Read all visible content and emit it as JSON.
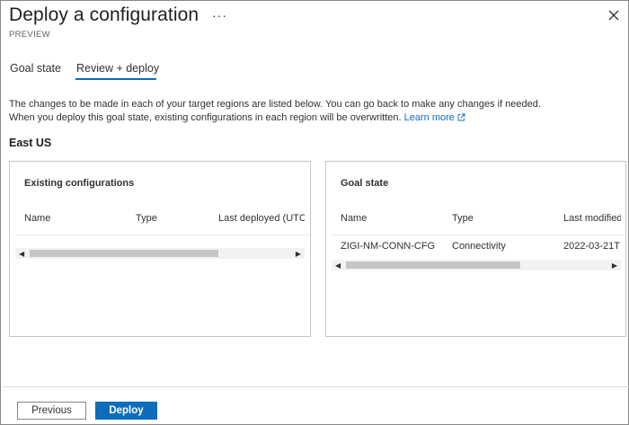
{
  "header": {
    "title": "Deploy a configuration",
    "subtitle": "PREVIEW",
    "more_label": "···"
  },
  "tabs": [
    {
      "label": "Goal state",
      "selected": false
    },
    {
      "label": "Review + deploy",
      "selected": true
    }
  ],
  "description": {
    "line1": "The changes to be made in each of your target regions are listed below. You can go back to make any changes if needed.",
    "line2": "When you deploy this goal state, existing configurations in each region will be overwritten.",
    "link": "Learn more"
  },
  "region": "East US",
  "existing": {
    "title": "Existing configurations",
    "columns": [
      "Name",
      "Type",
      "Last deployed (UTC)"
    ],
    "rows": []
  },
  "goal": {
    "title": "Goal state",
    "columns": [
      "Name",
      "Type",
      "Last modified"
    ],
    "rows": [
      {
        "name": "ZIGI-NM-CONN-CFG",
        "type": "Connectivity",
        "last": "2022-03-21T"
      }
    ]
  },
  "footer": {
    "previous": "Previous",
    "deploy": "Deploy"
  },
  "colors": {
    "accent": "#0f6cbd",
    "border": "#c8c6c4"
  }
}
